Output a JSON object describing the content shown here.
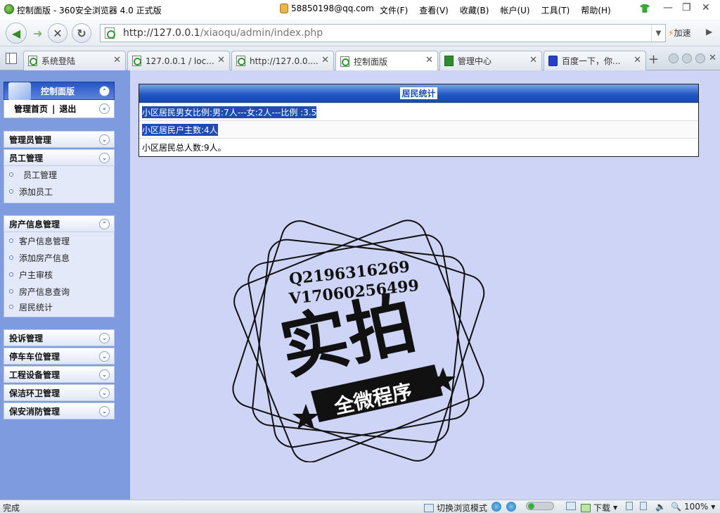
{
  "window": {
    "title": "控制面版 - 360安全浏览器 4.0 正式版",
    "user": "58850198@qq.com",
    "menus": [
      "文件(F)",
      "查看(V)",
      "收藏(B)",
      "帐户(U)",
      "工具(T)",
      "帮助(H)"
    ]
  },
  "navbar": {
    "url_host": "http://127.0.0.1",
    "url_path": "/xiaoqu/admin/index.php",
    "speed_label": "加速"
  },
  "tabs": [
    {
      "label": "系统登陆",
      "active": false
    },
    {
      "label": "127.0.0.1 / loc...",
      "active": false
    },
    {
      "label": "http://127.0.0....",
      "active": false
    },
    {
      "label": "控制面版",
      "active": true
    },
    {
      "label": "管理中心",
      "active": false
    },
    {
      "label": "百度一下，你...",
      "active": false
    }
  ],
  "sidebar": {
    "panel_title": "控制面版",
    "home_link": "管理首页",
    "separator": "|",
    "logout_link": "退出",
    "groups": [
      {
        "title": "管理员管理",
        "items": []
      },
      {
        "title": "员工管理",
        "items": [
          "员工管理",
          "添加员工"
        ]
      },
      {
        "title": "房产信息管理",
        "items": [
          "客户信息管理",
          "添加房产信息",
          "户主审核",
          "房产信息查询",
          "居民统计"
        ]
      },
      {
        "title": "投诉管理",
        "items": []
      },
      {
        "title": "停车车位管理",
        "items": []
      },
      {
        "title": "工程设备管理",
        "items": []
      },
      {
        "title": "保洁环卫管理",
        "items": []
      },
      {
        "title": "保安消防管理",
        "items": []
      }
    ]
  },
  "main": {
    "panel_title": "居民统计",
    "rows": [
      "小区居民男女比例:男:7人---女:2人---比例 :3.5",
      "小区居民户主数:4人",
      "小区居民总人数:9人。"
    ]
  },
  "watermark": {
    "line1": "Q2196316269",
    "line2": "V17060256499",
    "big": "实拍",
    "ribbon": "全微程序"
  },
  "statusbar": {
    "status": "完成",
    "switch_mode": "切换浏览模式",
    "download": "下载",
    "zoom": "100%"
  }
}
